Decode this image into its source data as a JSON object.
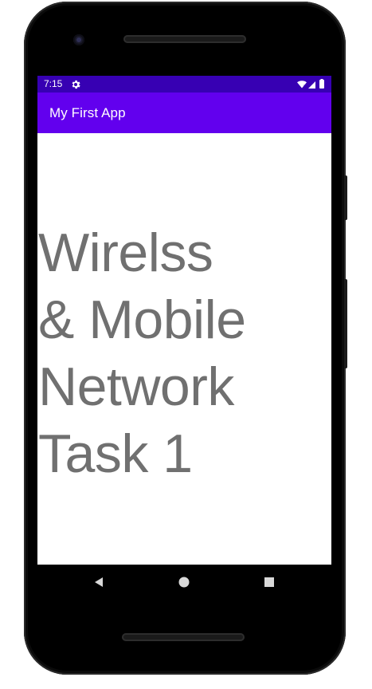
{
  "status_bar": {
    "time": "7:15",
    "gear_icon": "gear-icon",
    "wifi_icon": "wifi-icon",
    "signal_icon": "signal-icon",
    "battery_icon": "battery-icon",
    "background_color": "#3700b3"
  },
  "app_bar": {
    "title": "My First App",
    "background_color": "#6200ee"
  },
  "main": {
    "text": "Wirelss\n& Mobile\nNetwork\nTask 1",
    "text_color": "#707070"
  },
  "nav_bar": {
    "back_icon": "back-triangle-icon",
    "home_icon": "home-circle-icon",
    "recents_icon": "recents-square-icon"
  }
}
